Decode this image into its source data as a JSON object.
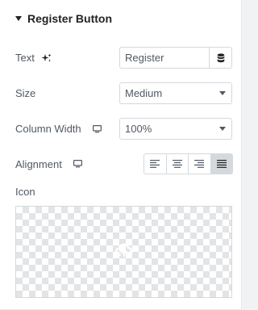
{
  "section": {
    "title": "Register Button",
    "expanded": true
  },
  "text_field": {
    "label": "Text",
    "label_icon": "ai-sparkle-icon",
    "value": "Register",
    "dynamic_icon": "database-icon"
  },
  "size_field": {
    "label": "Size",
    "selected": "Medium"
  },
  "column_width_field": {
    "label": "Column Width",
    "device_icon": "desktop-icon",
    "selected": "100%"
  },
  "alignment_field": {
    "label": "Alignment",
    "device_icon": "desktop-icon",
    "options": [
      "align-left-icon",
      "align-center-icon",
      "align-right-icon",
      "align-justify-icon"
    ],
    "active_index": 3
  },
  "icon_field": {
    "label": "Icon",
    "placeholder_icon": "upload-icon"
  },
  "colors": {
    "active_button_bg": "#d5d8dc",
    "text": "#515962",
    "title": "#1f2124"
  }
}
